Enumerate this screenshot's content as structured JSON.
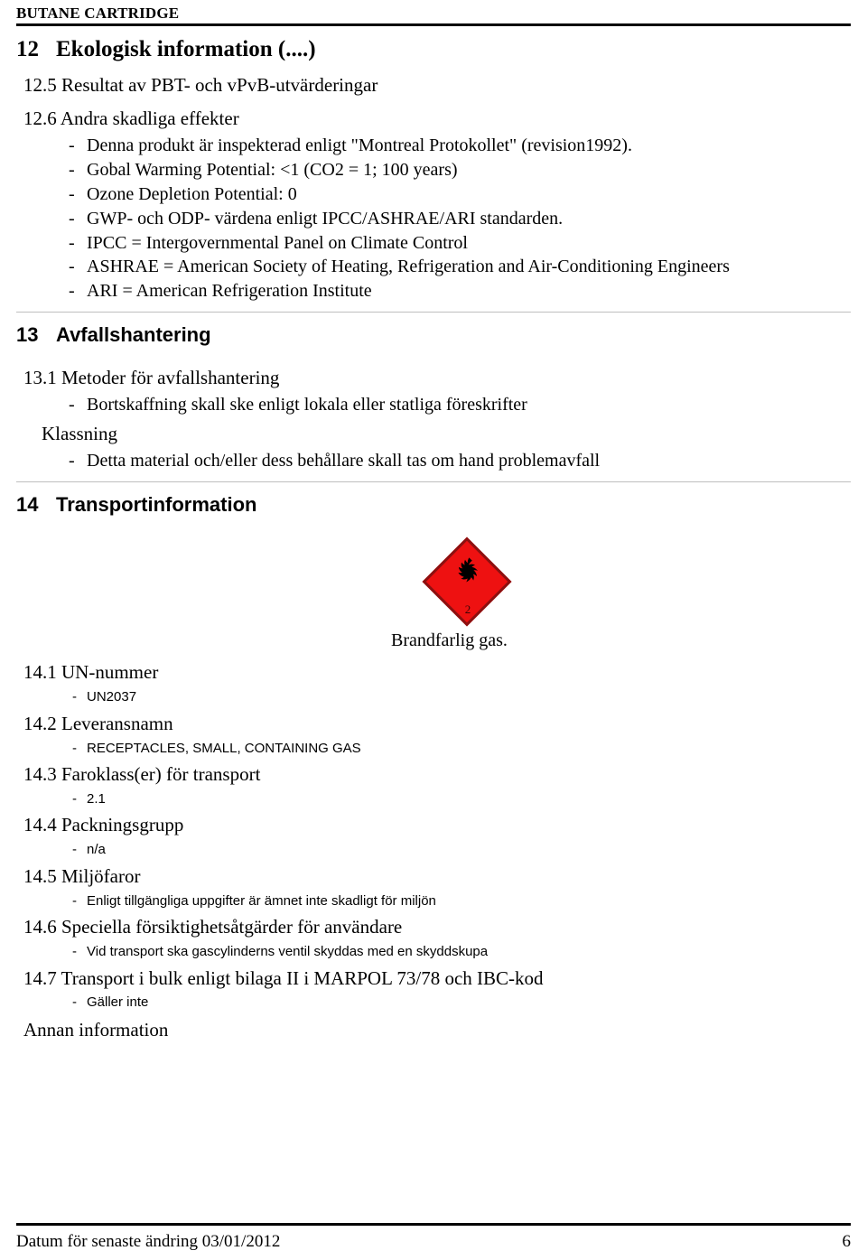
{
  "document": {
    "running_header": "BUTANE CARTRIDGE",
    "footer": {
      "revision_text": "Datum för senaste ändring 03/01/2012",
      "page_number": "6"
    }
  },
  "colors": {
    "hazard_red": "#ee1111",
    "hazard_border": "#8c1010",
    "rule_black": "#000000",
    "divider_gray": "#bfbfbf"
  },
  "section_12": {
    "number": "12",
    "title": "Ekologisk information (....)",
    "sub_12_5": {
      "label": "12.5 Resultat av PBT- och vPvB-utvärderingar"
    },
    "sub_12_6": {
      "label": "12.6 Andra skadliga effekter",
      "bullets": [
        "Denna produkt är inspekterad enligt \"Montreal Protokollet\" (revision1992).",
        "Gobal Warming Potential: <1 (CO2 = 1; 100 years)",
        "Ozone Depletion Potential: 0",
        "GWP- och ODP- värdena enligt IPCC/ASHRAE/ARI standarden.",
        "IPCC = Intergovernmental Panel on Climate Control",
        "ASHRAE = American Society of Heating, Refrigeration and Air-Conditioning Engineers",
        "ARI = American Refrigeration Institute"
      ]
    }
  },
  "section_13": {
    "number": "13",
    "title": "Avfallshantering",
    "sub_13_1": {
      "label": "13.1 Metoder för avfallshantering",
      "bullets": [
        "Bortskaffning skall ske enligt lokala eller statliga föreskrifter"
      ]
    },
    "klassning": {
      "label": "Klassning",
      "bullets": [
        "Detta material och/eller dess behållare skall tas om hand problemavfall"
      ]
    }
  },
  "section_14": {
    "number": "14",
    "title": "Transportinformation",
    "pictogram": {
      "icon_name": "flammable-gas-diamond",
      "class_number": "2",
      "caption": "Brandfarlig gas."
    },
    "sub_14_1": {
      "label": "14.1 UN-nummer",
      "bullets": [
        "UN2037"
      ]
    },
    "sub_14_2": {
      "label": "14.2 Leveransnamn",
      "bullets": [
        "RECEPTACLES, SMALL, CONTAINING GAS"
      ]
    },
    "sub_14_3": {
      "label": "14.3 Faroklass(er) för transport",
      "bullets": [
        "2.1"
      ]
    },
    "sub_14_4": {
      "label": "14.4 Packningsgrupp",
      "bullets": [
        "n/a"
      ]
    },
    "sub_14_5": {
      "label": "14.5 Miljöfaror",
      "bullets": [
        "Enligt tillgängliga uppgifter är ämnet inte skadligt för miljön"
      ]
    },
    "sub_14_6": {
      "label": "14.6 Speciella försiktighetsåtgärder för användare",
      "bullets": [
        "Vid transport ska gascylinderns ventil skyddas med en skyddskupa"
      ]
    },
    "sub_14_7": {
      "label": "14.7 Transport i bulk enligt bilaga II i MARPOL 73/78 och IBC-kod",
      "bullets": [
        "Gäller inte"
      ]
    },
    "other_info": {
      "label": "Annan information"
    }
  },
  "bullet_marker": "-"
}
